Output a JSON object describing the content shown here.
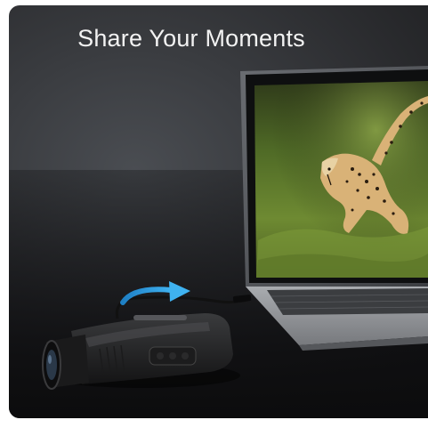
{
  "title": "Share Your Moments"
}
